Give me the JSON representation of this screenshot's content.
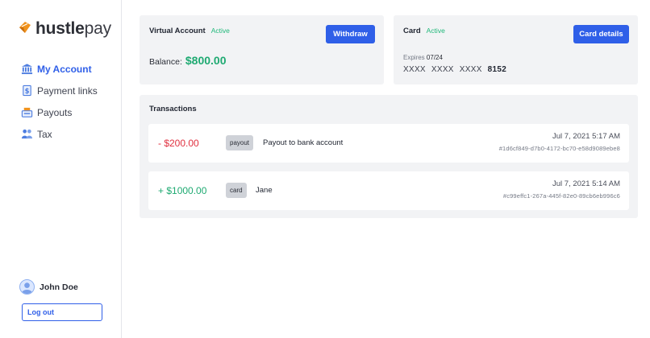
{
  "brand": {
    "name_strong": "hustle",
    "name_light": "pay",
    "accent": "#f0931e"
  },
  "nav": {
    "items": [
      {
        "label": "My Account",
        "icon": "bank-icon",
        "active": true
      },
      {
        "label": "Payment links",
        "icon": "dollar-document-icon",
        "active": false
      },
      {
        "label": "Payouts",
        "icon": "cash-register-icon",
        "active": false
      },
      {
        "label": "Tax",
        "icon": "people-icon",
        "active": false
      }
    ]
  },
  "user": {
    "name": "John Doe",
    "logout_label": "Log out"
  },
  "virtual_account": {
    "title": "Virtual Account",
    "status": "Active",
    "button_label": "Withdraw",
    "balance_label": "Balance:",
    "balance_value": "$800.00"
  },
  "card": {
    "title": "Card",
    "status": "Active",
    "button_label": "Card details",
    "expires_label": "Expires",
    "expires_value": "07/24",
    "number_groups": [
      "XXXX",
      "XXXX",
      "XXXX"
    ],
    "last4": "8152"
  },
  "transactions": {
    "title": "Transactions",
    "items": [
      {
        "amount": "- $200.00",
        "type": "payout",
        "description": "Payout to bank account",
        "date": "Jul 7, 2021 5:17 AM",
        "id": "#1d6cf849-d7b0-4172-bc70-e58d9089ebe8"
      },
      {
        "amount": "+ $1000.00",
        "type": "card",
        "description": "Jane",
        "date": "Jul 7, 2021 5:14 AM",
        "id": "#c99effc1-267a-445f-82e0-89cb6eb996c6"
      }
    ]
  },
  "colors": {
    "primary": "#2f5fe8",
    "positive": "#1faa72",
    "negative": "#e0303f",
    "panel_bg": "#f2f3f5"
  }
}
